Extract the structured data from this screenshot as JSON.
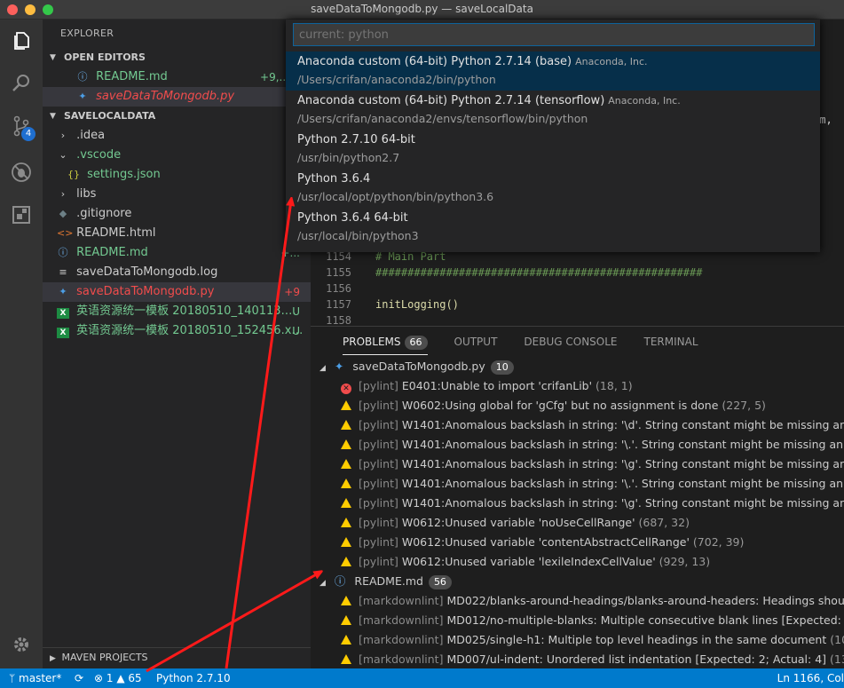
{
  "window": {
    "title": "saveDataToMongodb.py — saveLocalData",
    "colors": {
      "close": "#fc605c",
      "minimize": "#fdbc40",
      "zoom": "#34c84a"
    }
  },
  "activity": {
    "items": [
      "files-icon",
      "search-icon",
      "source-control-icon",
      "debug-icon",
      "extensions-icon",
      "settings-gear-icon"
    ],
    "scm_badge": "4"
  },
  "sidebar": {
    "title": "EXPLORER",
    "open_editors": {
      "header": "OPEN EDITORS",
      "items": [
        {
          "icon": "ⓘ",
          "name": "README.md",
          "tag": "+9,..."
        },
        {
          "icon": "py",
          "name": "saveDataToMongodb.py",
          "tag": ""
        }
      ]
    },
    "folder": {
      "header": "SAVELOCALDATA",
      "items": [
        {
          "icon": "›",
          "name": ".idea",
          "tag": ""
        },
        {
          "icon": "⌄",
          "name": ".vscode",
          "tag": ""
        },
        {
          "icon": "{}",
          "name": "settings.json",
          "tag": ""
        },
        {
          "icon": "›",
          "name": "libs",
          "tag": ""
        },
        {
          "icon": "◆",
          "name": ".gitignore",
          "tag": ""
        },
        {
          "icon": "<>",
          "name": "README.html",
          "tag": ""
        },
        {
          "icon": "ⓘ",
          "name": "README.md",
          "tag": "+..."
        },
        {
          "icon": "≡",
          "name": "saveDataToMongodb.log",
          "tag": ""
        },
        {
          "icon": "py",
          "name": "saveDataToMongodb.py",
          "tag": "+9"
        },
        {
          "icon": "X",
          "name": "英语资源统一模板 20180510_140113.…",
          "tag": "U"
        },
        {
          "icon": "X",
          "name": "英语资源统一模板 20180510_152456.x…",
          "tag": "U"
        }
      ]
    },
    "maven": "MAVEN PROJECTS"
  },
  "quick_pick": {
    "placeholder": "current: python",
    "items": [
      {
        "label": "Anaconda custom (64-bit) Python 2.7.14 (base)",
        "description": "Anaconda, Inc.",
        "path": "/Users/crifan/anaconda2/bin/python"
      },
      {
        "label": "Anaconda custom (64-bit) Python 2.7.14 (tensorflow)",
        "description": "Anaconda, Inc.",
        "path": "/Users/crifan/anaconda2/envs/tensorflow/bin/python"
      },
      {
        "label": "Python 2.7.10 64-bit",
        "description": "",
        "path": "/usr/bin/python2.7"
      },
      {
        "label": "Python 3.6.4",
        "description": "",
        "path": "/usr/local/opt/python/bin/python3.6"
      },
      {
        "label": "Python 3.6.4 64-bit",
        "description": "",
        "path": "/usr/local/bin/python3"
      }
    ]
  },
  "editor": {
    "right_fragments": [
      ",",
      "um,",
      ":"
    ],
    "lines": [
      {
        "num": "",
        "code": "###################################################"
      },
      {
        "num": "1154",
        "code": "# Main Part"
      },
      {
        "num": "1155",
        "code": "###################################################"
      },
      {
        "num": "1156",
        "code": ""
      },
      {
        "num": "1157",
        "code": "initLogging()"
      },
      {
        "num": "1158",
        "code": ""
      }
    ]
  },
  "panel": {
    "tabs": [
      {
        "label": "PROBLEMS",
        "count": "66"
      },
      {
        "label": "OUTPUT",
        "count": ""
      },
      {
        "label": "DEBUG CONSOLE",
        "count": ""
      },
      {
        "label": "TERMINAL",
        "count": ""
      }
    ],
    "groups": [
      {
        "file": "saveDataToMongodb.py",
        "count": "10",
        "items": [
          {
            "severity": "error",
            "source": "[pylint]",
            "message": "E0401:Unable to import 'crifanLib'",
            "location": "(18, 1)"
          },
          {
            "severity": "warning",
            "source": "[pylint]",
            "message": "W0602:Using global for 'gCfg' but no assignment is done",
            "location": "(227, 5)"
          },
          {
            "severity": "warning",
            "source": "[pylint]",
            "message": "W1401:Anomalous backslash in string: '\\d'. String constant might be missing an r",
            "location": ""
          },
          {
            "severity": "warning",
            "source": "[pylint]",
            "message": "W1401:Anomalous backslash in string: '\\.'. String constant might be missing an r p",
            "location": ""
          },
          {
            "severity": "warning",
            "source": "[pylint]",
            "message": "W1401:Anomalous backslash in string: '\\g'. String constant might be missing an r",
            "location": ""
          },
          {
            "severity": "warning",
            "source": "[pylint]",
            "message": "W1401:Anomalous backslash in string: '\\.'. String constant might be missing an r p",
            "location": ""
          },
          {
            "severity": "warning",
            "source": "[pylint]",
            "message": "W1401:Anomalous backslash in string: '\\g'. String constant might be missing an r",
            "location": ""
          },
          {
            "severity": "warning",
            "source": "[pylint]",
            "message": "W0612:Unused variable 'noUseCellRange'",
            "location": "(687, 32)"
          },
          {
            "severity": "warning",
            "source": "[pylint]",
            "message": "W0612:Unused variable 'contentAbstractCellRange'",
            "location": "(702, 39)"
          },
          {
            "severity": "warning",
            "source": "[pylint]",
            "message": "W0612:Unused variable 'lexileIndexCellValue'",
            "location": "(929, 13)"
          }
        ]
      },
      {
        "file": "README.md",
        "count": "56",
        "items": [
          {
            "severity": "warning",
            "source": "[markdownlint]",
            "message": "MD022/blanks-around-headings/blanks-around-headers: Headings shoul",
            "location": ""
          },
          {
            "severity": "warning",
            "source": "[markdownlint]",
            "message": "MD012/no-multiple-blanks: Multiple consecutive blank lines [Expected: 1;",
            "location": ""
          },
          {
            "severity": "warning",
            "source": "[markdownlint]",
            "message": "MD025/single-h1: Multiple top level headings in the same document",
            "location": "(10,"
          },
          {
            "severity": "warning",
            "source": "[markdownlint]",
            "message": "MD007/ul-indent: Unordered list indentation [Expected: 2; Actual: 4]",
            "location": "(13,"
          }
        ]
      }
    ]
  },
  "statusbar": {
    "branch": "master*",
    "errors": "1",
    "warnings": "65",
    "interpreter": "Python 2.7.10",
    "cursor": "Ln 1166, Col"
  },
  "accent": "#007acc",
  "annotation_color": "#ff1a1a"
}
